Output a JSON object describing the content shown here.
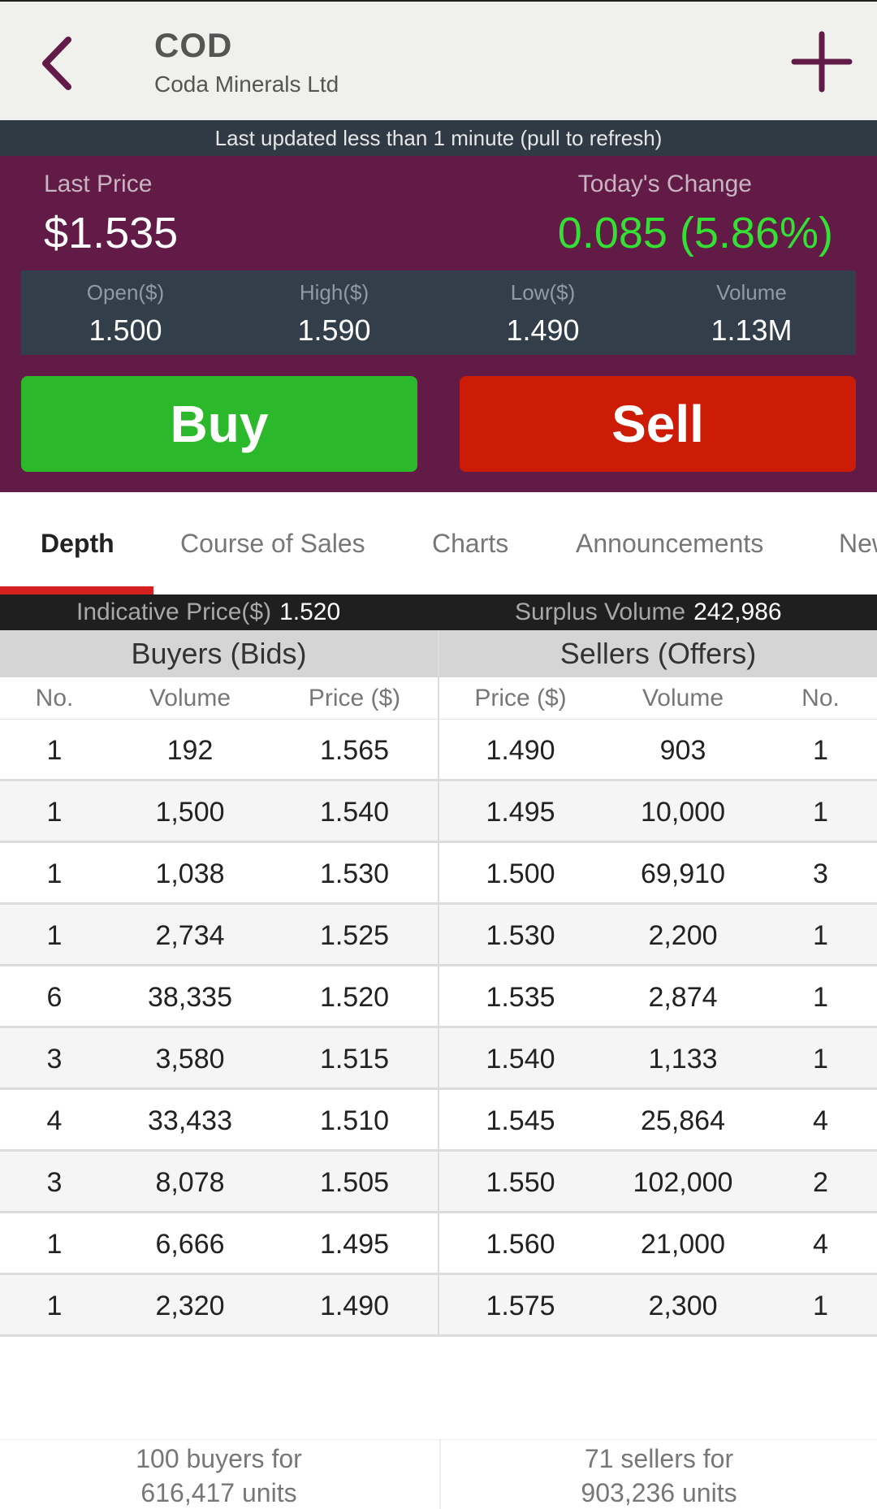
{
  "header": {
    "ticker": "COD",
    "company": "Coda Minerals Ltd",
    "back_icon": "chevron-left-icon",
    "add_icon": "plus-icon",
    "accent": "#621a47"
  },
  "update_bar": {
    "text": "Last updated less than 1 minute (pull to refresh)"
  },
  "quote": {
    "last_price_label": "Last Price",
    "last_price": "$1.535",
    "change_label": "Today's Change",
    "change": "0.085 (5.86%)",
    "change_color": "#33e033",
    "stats": [
      {
        "label": "Open($)",
        "value": "1.500"
      },
      {
        "label": "High($)",
        "value": "1.590"
      },
      {
        "label": "Low($)",
        "value": "1.490"
      },
      {
        "label": "Volume",
        "value": "1.13M"
      }
    ],
    "buy_label": "Buy",
    "sell_label": "Sell",
    "buy_color": "#2bb92b",
    "sell_color": "#cc1c05"
  },
  "tabs": [
    {
      "label": "Depth",
      "active": true
    },
    {
      "label": "Course of Sales",
      "active": false
    },
    {
      "label": "Charts",
      "active": false
    },
    {
      "label": "Announcements",
      "active": false
    },
    {
      "label": "News",
      "active": false
    }
  ],
  "indicative": {
    "price_label": "Indicative Price($)",
    "price": "1.520",
    "surplus_label": "Surplus Volume",
    "surplus": "242,986"
  },
  "depth": {
    "buyers_title": "Buyers (Bids)",
    "sellers_title": "Sellers (Offers)",
    "columns": [
      "No.",
      "Volume",
      "Price ($)",
      "Price ($)",
      "Volume",
      "No."
    ],
    "rows": [
      {
        "bid_no": "1",
        "bid_vol": "192",
        "bid_price": "1.565",
        "ask_price": "1.490",
        "ask_vol": "903",
        "ask_no": "1"
      },
      {
        "bid_no": "1",
        "bid_vol": "1,500",
        "bid_price": "1.540",
        "ask_price": "1.495",
        "ask_vol": "10,000",
        "ask_no": "1"
      },
      {
        "bid_no": "1",
        "bid_vol": "1,038",
        "bid_price": "1.530",
        "ask_price": "1.500",
        "ask_vol": "69,910",
        "ask_no": "3"
      },
      {
        "bid_no": "1",
        "bid_vol": "2,734",
        "bid_price": "1.525",
        "ask_price": "1.530",
        "ask_vol": "2,200",
        "ask_no": "1"
      },
      {
        "bid_no": "6",
        "bid_vol": "38,335",
        "bid_price": "1.520",
        "ask_price": "1.535",
        "ask_vol": "2,874",
        "ask_no": "1"
      },
      {
        "bid_no": "3",
        "bid_vol": "3,580",
        "bid_price": "1.515",
        "ask_price": "1.540",
        "ask_vol": "1,133",
        "ask_no": "1"
      },
      {
        "bid_no": "4",
        "bid_vol": "33,433",
        "bid_price": "1.510",
        "ask_price": "1.545",
        "ask_vol": "25,864",
        "ask_no": "4"
      },
      {
        "bid_no": "3",
        "bid_vol": "8,078",
        "bid_price": "1.505",
        "ask_price": "1.550",
        "ask_vol": "102,000",
        "ask_no": "2"
      },
      {
        "bid_no": "1",
        "bid_vol": "6,666",
        "bid_price": "1.495",
        "ask_price": "1.560",
        "ask_vol": "21,000",
        "ask_no": "4"
      },
      {
        "bid_no": "1",
        "bid_vol": "2,320",
        "bid_price": "1.490",
        "ask_price": "1.575",
        "ask_vol": "2,300",
        "ask_no": "1"
      }
    ]
  },
  "footer": {
    "buyers_line1": "100 buyers for",
    "buyers_line2": "616,417 units",
    "sellers_line1": "71 sellers for",
    "sellers_line2": "903,236 units"
  }
}
